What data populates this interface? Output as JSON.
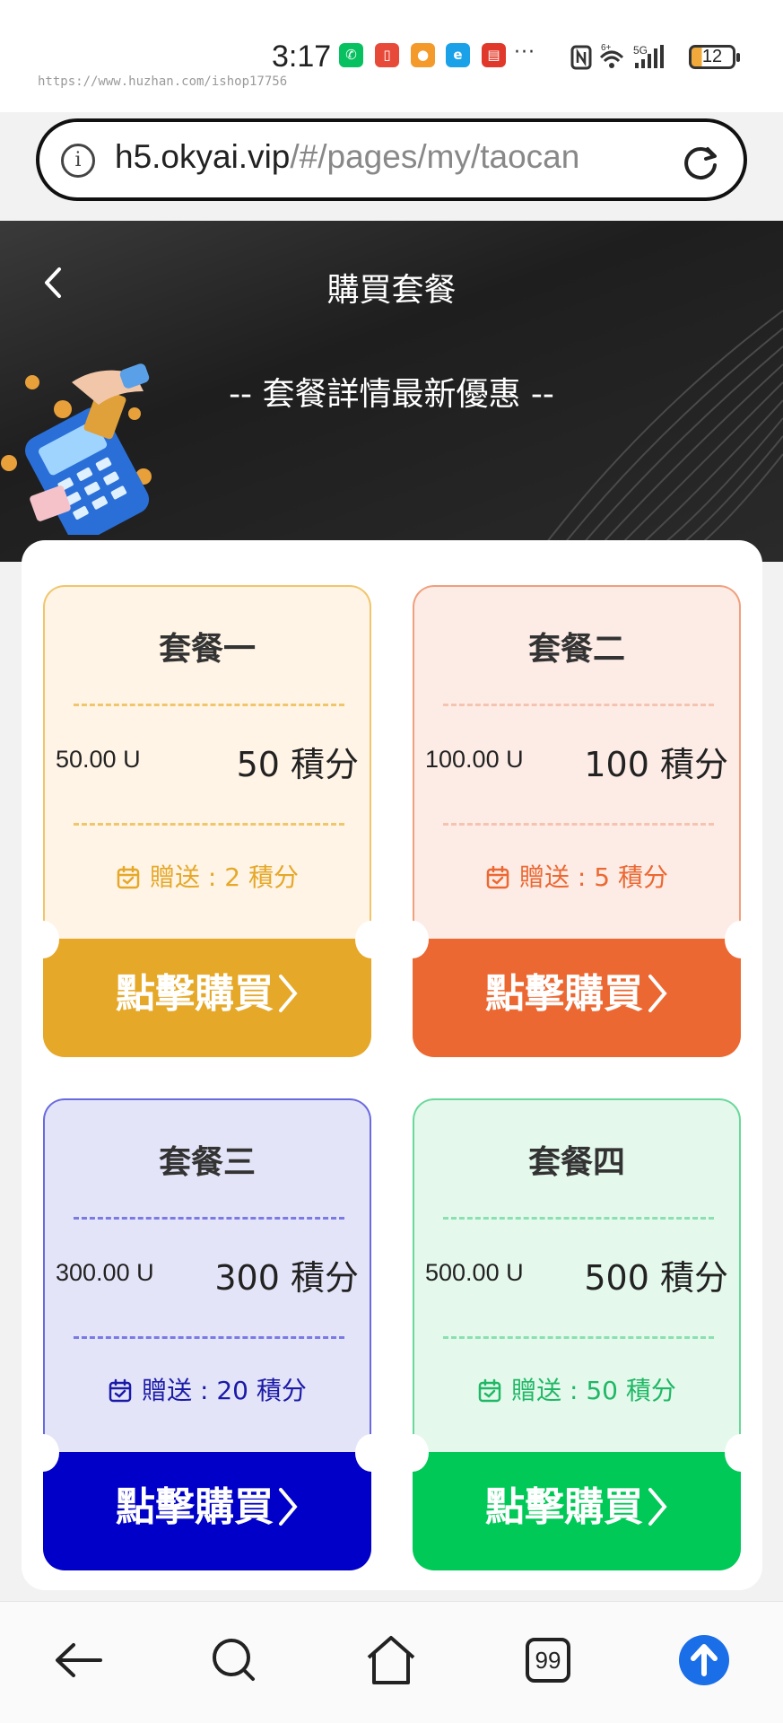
{
  "status_bar": {
    "time": "3:17",
    "overflow": "···",
    "battery": "12",
    "watermark": "https://www.huzhan.com/ishop17756"
  },
  "browser": {
    "url_domain": "h5.okyai.vip",
    "url_path": "/#/pages/my/taocan"
  },
  "header": {
    "title": "購買套餐",
    "subtitle": "-- 套餐詳情最新優惠 --"
  },
  "packages": [
    {
      "title": "套餐一",
      "price": "50.00 U",
      "points": "50 積分",
      "gift": "贈送 : 2 積分",
      "button": "點擊購買",
      "accent": "#e5a828",
      "bg": "#fff4e6",
      "border": "#f0c66c"
    },
    {
      "title": "套餐二",
      "price": "100.00 U",
      "points": "100 積分",
      "gift": "贈送 : 5 積分",
      "button": "點擊購買",
      "accent": "#ec6832",
      "bg": "#fdece6",
      "border": "#f0a07e"
    },
    {
      "title": "套餐三",
      "price": "300.00 U",
      "points": "300 積分",
      "gift": "贈送 : 20 積分",
      "button": "點擊購買",
      "accent": "#0000c8",
      "bg": "#e4e4f8",
      "border": "#6a6ae0"
    },
    {
      "title": "套餐四",
      "price": "500.00 U",
      "points": "500 積分",
      "gift": "贈送 : 50 積分",
      "button": "點擊購買",
      "accent": "#00c957",
      "bg": "#e4f8ec",
      "border": "#6ad89a"
    }
  ],
  "bottom_nav": {
    "tabs_count": "99",
    "items": [
      "back-icon",
      "search-icon",
      "home-icon",
      "tabs-icon",
      "upload-icon"
    ]
  }
}
